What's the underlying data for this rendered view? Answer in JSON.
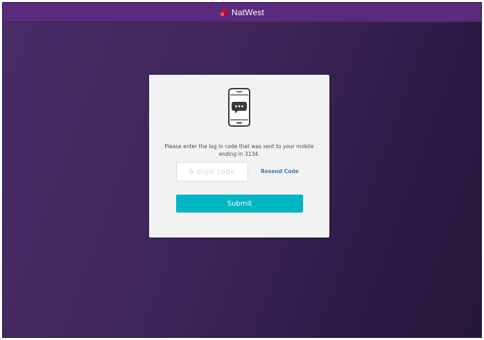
{
  "header": {
    "brand_name": "NatWest",
    "logo_icon": "natwest-cubes-logo",
    "background_color": "#5a2a7e"
  },
  "page": {
    "background_color": "#3e2559"
  },
  "card": {
    "icon": "phone-chat-icon",
    "message": "Please enter the log in code that was sent to your mobile ending in 3134.",
    "code_input": {
      "value": "",
      "placeholder": "6 digit code"
    },
    "resend_label": "Resend Code",
    "submit_label": "Submit",
    "accent_color": "#00b5c4",
    "link_color": "#3b7ab8"
  }
}
